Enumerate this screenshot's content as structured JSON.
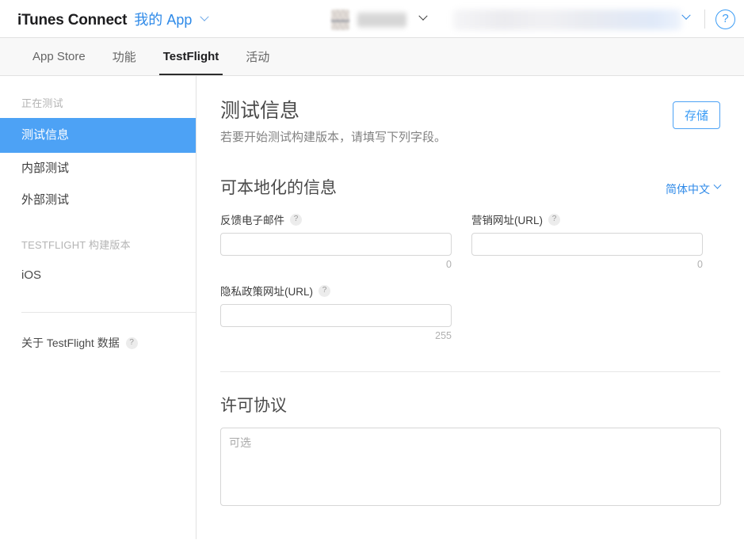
{
  "header": {
    "brand_title": "iTunes Connect",
    "brand_sub": "我的 App",
    "app_switcher_name": "",
    "account_name": "",
    "help_label": "?"
  },
  "tabs": [
    {
      "label": "App Store",
      "active": false
    },
    {
      "label": "功能",
      "active": false
    },
    {
      "label": "TestFlight",
      "active": true
    },
    {
      "label": "活动",
      "active": false
    }
  ],
  "sidebar": {
    "section_testing": "正在测试",
    "items": [
      {
        "label": "测试信息",
        "active": true
      },
      {
        "label": "内部测试",
        "active": false
      },
      {
        "label": "外部测试",
        "active": false
      }
    ],
    "section_builds": "TESTFLIGHT 构建版本",
    "build_items": [
      {
        "label": "iOS"
      }
    ],
    "footer_label": "关于 TestFlight 数据",
    "footer_help": "?"
  },
  "main": {
    "page_title": "测试信息",
    "page_subtitle": "若要开始测试构建版本，请填写下列字段。",
    "save_label": "存储",
    "localizable": {
      "title": "可本地化的信息",
      "language": "简体中文",
      "fields": [
        {
          "label": "反馈电子邮件",
          "help": "?",
          "value": "",
          "counter": "0"
        },
        {
          "label": "营销网址(URL)",
          "help": "?",
          "value": "",
          "counter": "0"
        },
        {
          "label": "隐私政策网址(URL)",
          "help": "?",
          "value": "",
          "counter": "255"
        }
      ]
    },
    "license": {
      "title": "许可协议",
      "placeholder": "可选",
      "value": ""
    }
  }
}
